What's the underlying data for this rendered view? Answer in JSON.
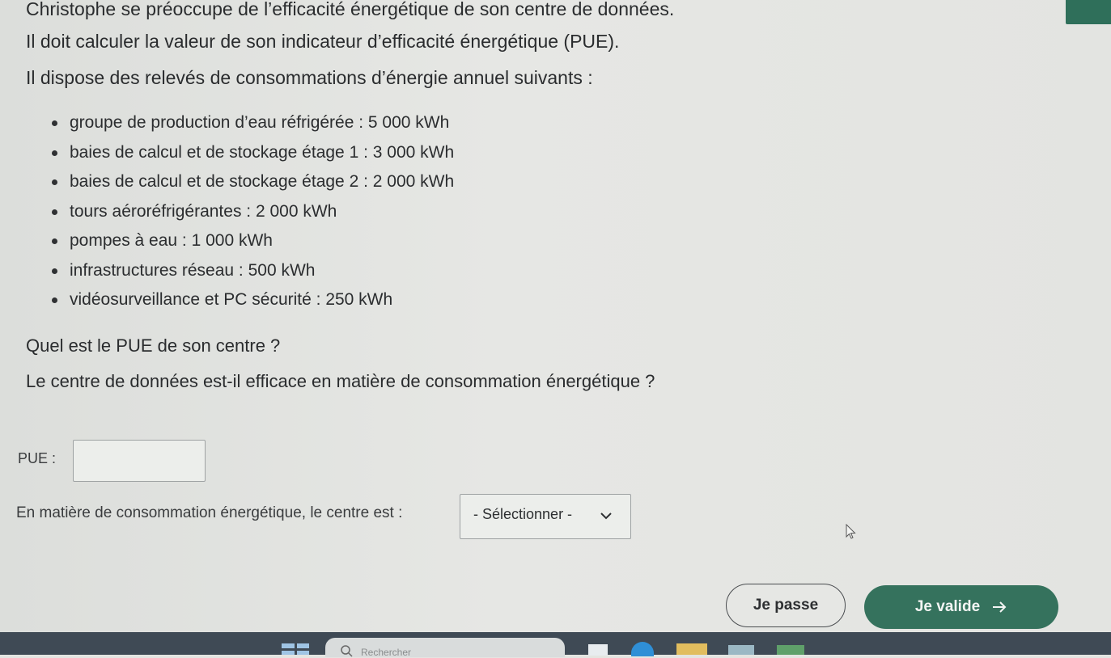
{
  "intro": {
    "line1": "Christophe se préoccupe de l’efficacité énergétique de son centre de données.",
    "line2": "Il doit calculer la valeur de son indicateur d’efficacité énergétique (PUE).",
    "line3": "Il dispose des relevés de consommations d’énergie annuel suivants :"
  },
  "readings": [
    "groupe de production d’eau réfrigérée : 5 000 kWh",
    "baies de calcul et de stockage étage 1 : 3 000 kWh",
    "baies de calcul et de stockage étage 2 : 2 000 kWh",
    "tours aéroréfrigérantes : 2 000 kWh",
    "pompes à eau : 1 000 kWh",
    "infrastructures réseau : 500 kWh",
    "vidéosurveillance et PC sécurité : 250 kWh"
  ],
  "questions": {
    "q1": "Quel est le PUE de son centre ?",
    "q2": "Le centre de données est-il efficace en matière de consommation énergétique ?"
  },
  "form": {
    "pue_label": "PUE :",
    "pue_value": "",
    "consumption_label": "En matière de consommation énergétique, le centre est :",
    "consumption_selected": "- Sélectionner -"
  },
  "buttons": {
    "skip": "Je passe",
    "validate": "Je valide"
  },
  "taskbar": {
    "search_placeholder": "Rechercher"
  },
  "colors": {
    "accent": "#35725d",
    "taskbar": "#3f4a55"
  }
}
